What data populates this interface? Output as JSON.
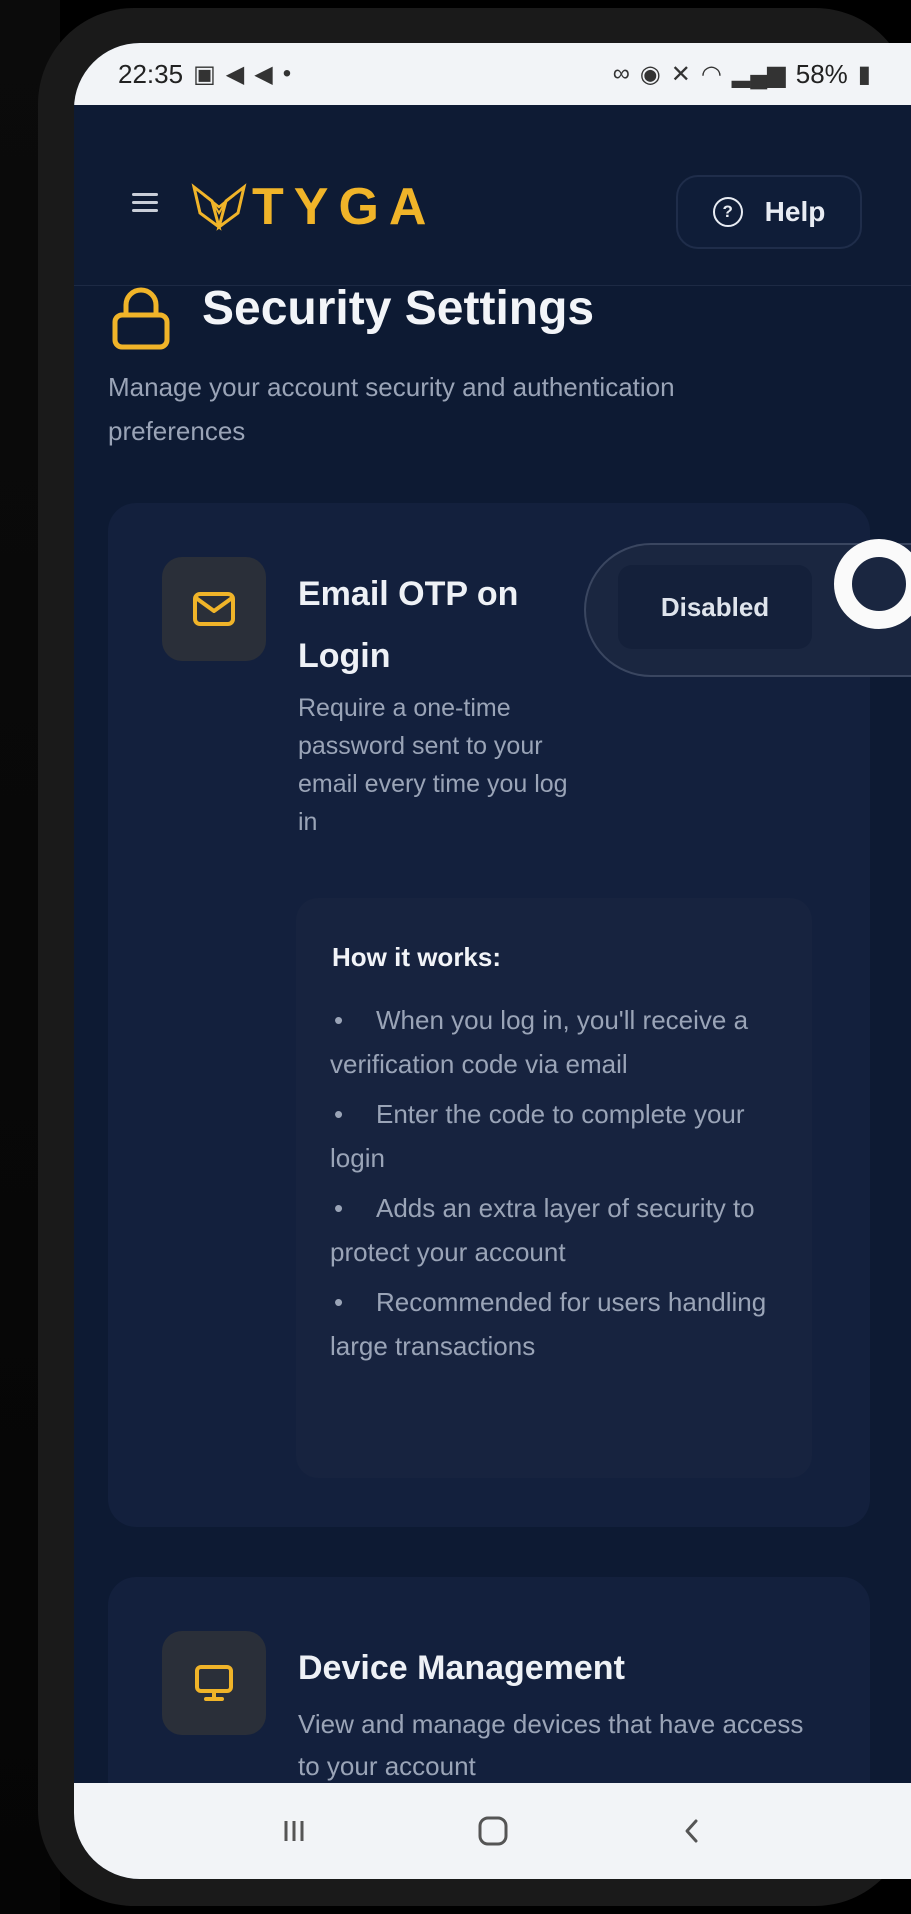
{
  "status_bar": {
    "time": "22:35",
    "battery": "58%"
  },
  "header": {
    "logo_text": "TYGA",
    "help_label": "Help"
  },
  "page": {
    "title": "Security Settings",
    "subtitle": "Manage your account security and authentication preferences"
  },
  "email_otp": {
    "title_line1": "Email OTP on",
    "title_line2": "Login",
    "description": "Require a one-time password sent to your email every time you log in",
    "toggle_state": "Disabled",
    "how_it_works": {
      "title": "How it works:",
      "items": [
        "When you log in, you'll receive a verification code via email",
        "Enter the code to complete your login",
        "Adds an extra layer of security to protect your account",
        "Recommended for users handling large transactions"
      ]
    }
  },
  "device_management": {
    "title": "Device Management",
    "description": "View and manage devices that have access to your account"
  },
  "colors": {
    "accent": "#f0b429",
    "background": "#0d1a33",
    "card": "#13203d"
  }
}
